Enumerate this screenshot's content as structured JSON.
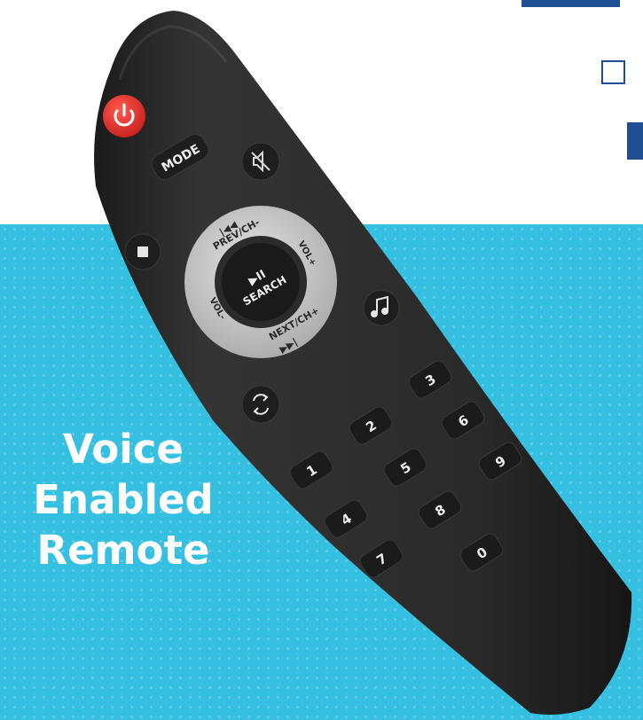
{
  "caption": {
    "line1": "Voice",
    "line2": "Enabled",
    "line3": "Remote"
  },
  "remote": {
    "mode_label": "MODE",
    "prev_label": "PREV/CH-",
    "prev_glyph": "|◀◀",
    "next_label": "NEXT/CH+",
    "next_glyph": "▶▶|",
    "vol_up_label": "VOL+",
    "vol_down_label": "VOL-",
    "center_glyph": "▶II",
    "center_label": "SEARCH",
    "digits": [
      "1",
      "2",
      "3",
      "4",
      "5",
      "6",
      "7",
      "8",
      "9",
      "0"
    ]
  },
  "icons": {
    "power": "power-icon",
    "mute": "mute-icon",
    "stop": "stop-icon",
    "music": "music-note-icon",
    "repeat": "repeat-icon"
  },
  "colors": {
    "background": "#35bfe0",
    "accent_navy": "#1f4e92",
    "remote_body": "#2c2c2c",
    "power_button": "#e5312f",
    "dpad_ring": "#c9c9c9"
  }
}
